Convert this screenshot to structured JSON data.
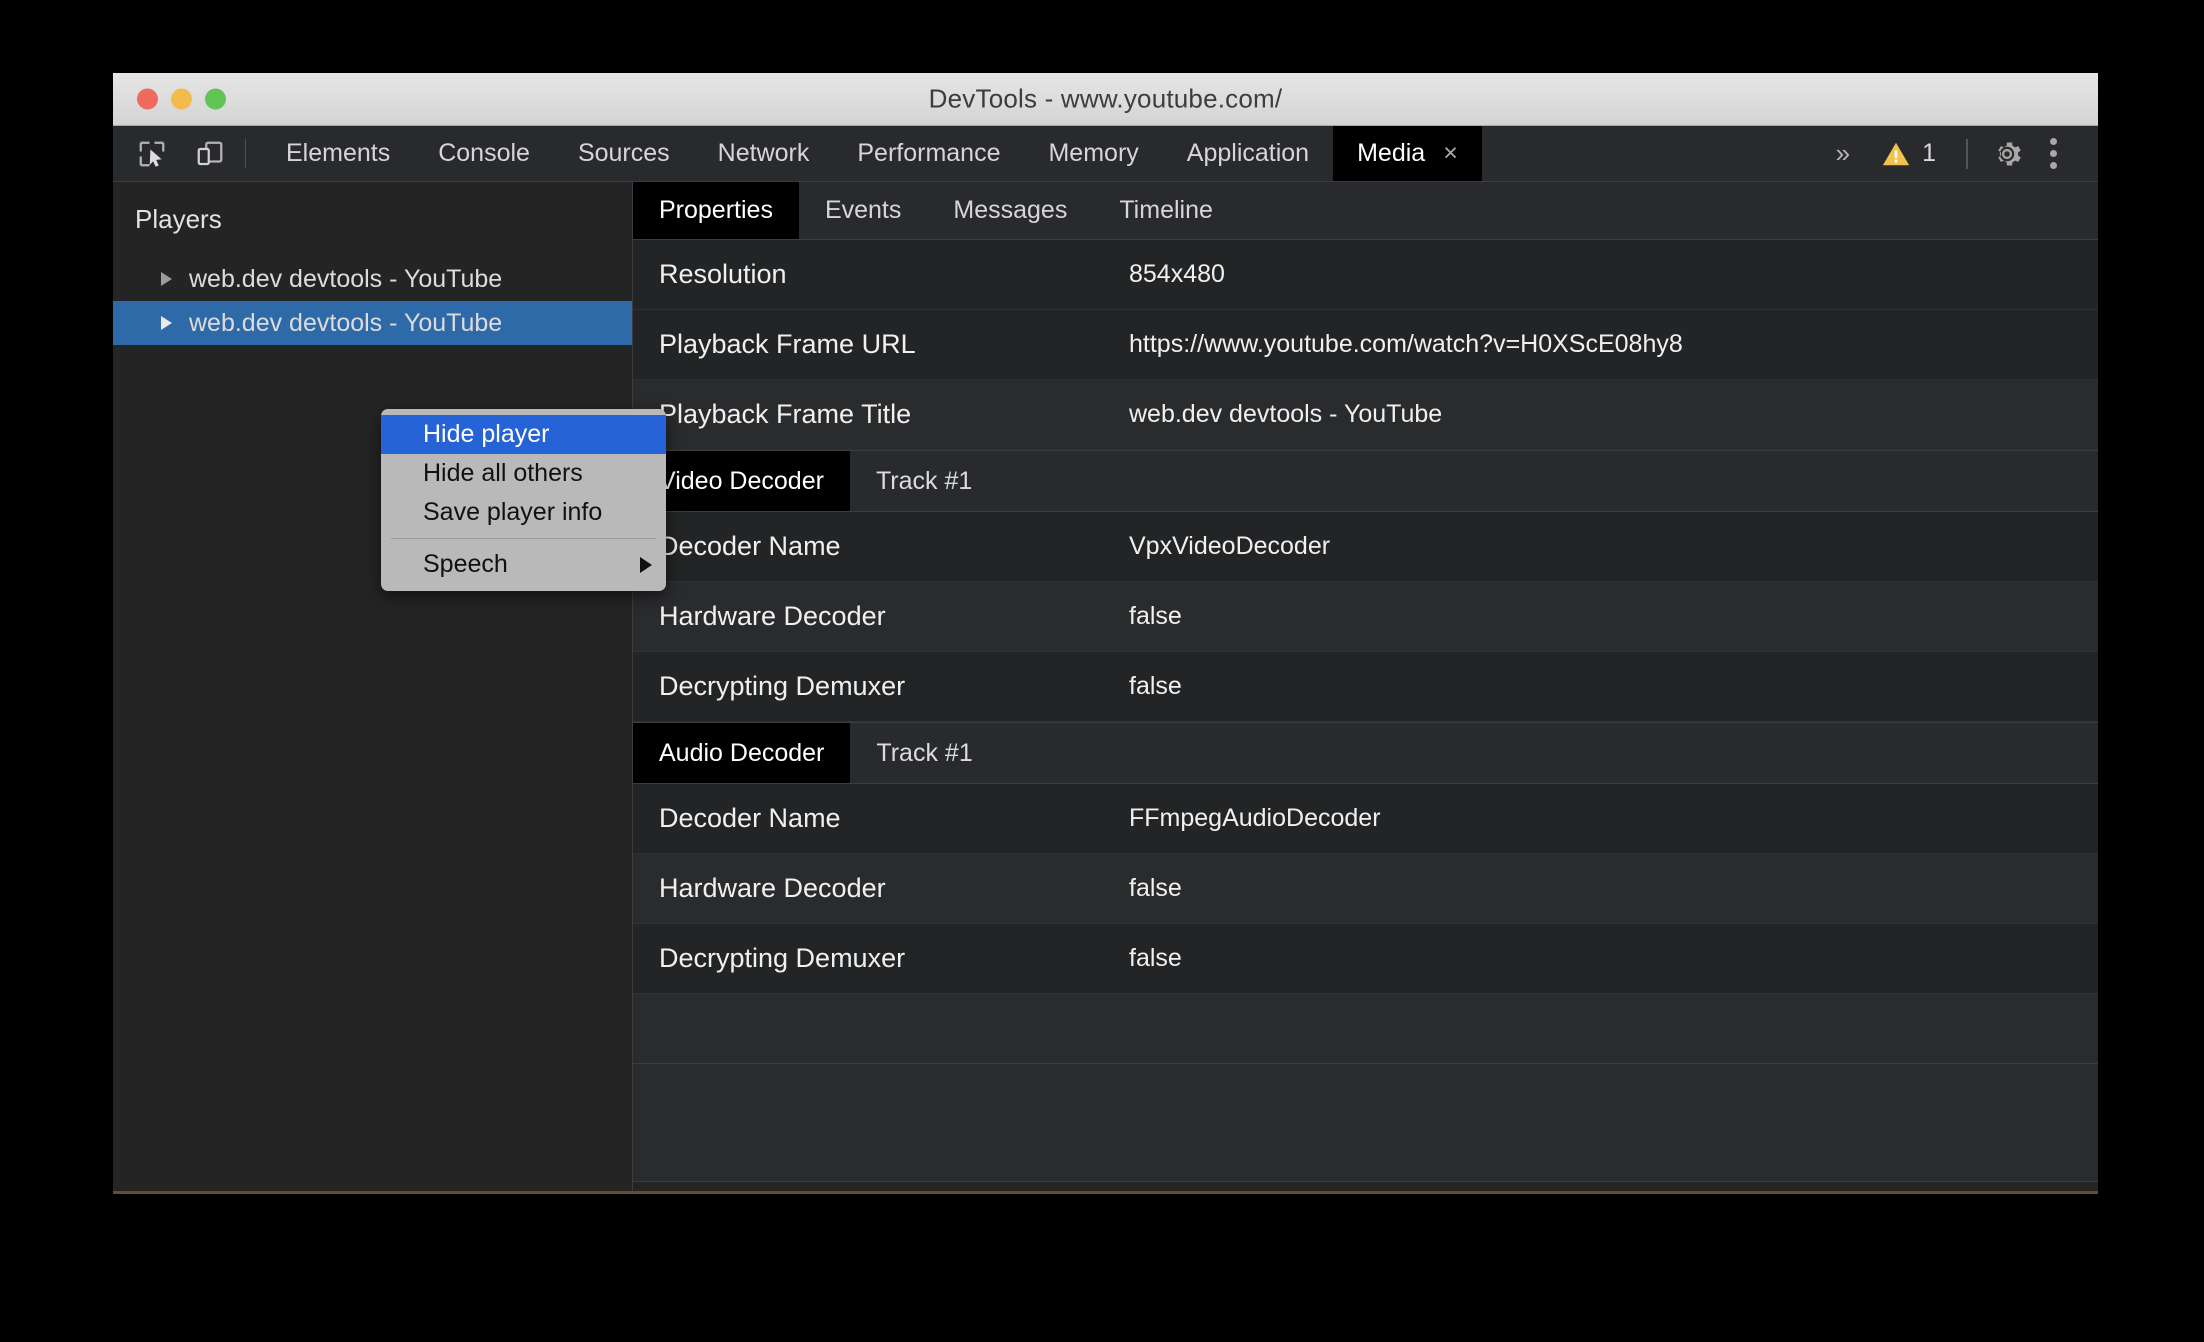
{
  "window": {
    "title": "DevTools - www.youtube.com/",
    "traffic_lights": [
      "close",
      "minimize",
      "zoom"
    ]
  },
  "toolbar": {
    "inspect_icon": "inspect-cursor-icon",
    "device_icon": "device-toolbar-icon",
    "tabs": [
      {
        "label": "Elements",
        "active": false,
        "closable": false
      },
      {
        "label": "Console",
        "active": false,
        "closable": false
      },
      {
        "label": "Sources",
        "active": false,
        "closable": false
      },
      {
        "label": "Network",
        "active": false,
        "closable": false
      },
      {
        "label": "Performance",
        "active": false,
        "closable": false
      },
      {
        "label": "Memory",
        "active": false,
        "closable": false
      },
      {
        "label": "Application",
        "active": false,
        "closable": false
      },
      {
        "label": "Media",
        "active": true,
        "closable": true
      }
    ],
    "close_glyph": "×",
    "more_tabs_glyph": "»",
    "warning_icon": "warning-triangle-icon",
    "warning_count": "1",
    "warning_color": "#f2c14e",
    "settings_icon": "gear-icon",
    "menu_icon": "kebab-menu-icon"
  },
  "sidebar": {
    "title": "Players",
    "players": [
      {
        "label": "web.dev devtools - YouTube",
        "selected": false
      },
      {
        "label": "web.dev devtools - YouTube",
        "selected": true
      }
    ]
  },
  "main": {
    "tabs": [
      {
        "label": "Properties",
        "active": true
      },
      {
        "label": "Events",
        "active": false
      },
      {
        "label": "Messages",
        "active": false
      },
      {
        "label": "Timeline",
        "active": false
      }
    ],
    "properties": [
      {
        "key": "Resolution",
        "value": "854x480"
      },
      {
        "key": "Playback Frame URL",
        "value": "https://www.youtube.com/watch?v=H0XScE08hy8"
      },
      {
        "key": "Playback Frame Title",
        "value": "web.dev devtools - YouTube"
      }
    ],
    "video_decoder": {
      "section_label": "Video Decoder",
      "track_label": "Track #1",
      "rows": [
        {
          "key": "Decoder Name",
          "value": "VpxVideoDecoder"
        },
        {
          "key": "Hardware Decoder",
          "value": "false"
        },
        {
          "key": "Decrypting Demuxer",
          "value": "false"
        }
      ]
    },
    "audio_decoder": {
      "section_label": "Audio Decoder",
      "track_label": "Track #1",
      "rows": [
        {
          "key": "Decoder Name",
          "value": "FFmpegAudioDecoder"
        },
        {
          "key": "Hardware Decoder",
          "value": "false"
        },
        {
          "key": "Decrypting Demuxer",
          "value": "false"
        }
      ]
    }
  },
  "context_menu": {
    "items": [
      {
        "label": "Hide player",
        "highlighted": true,
        "submenu": false
      },
      {
        "label": "Hide all others",
        "highlighted": false,
        "submenu": false
      },
      {
        "label": "Save player info",
        "highlighted": false,
        "submenu": false
      }
    ],
    "submenu_item": {
      "label": "Speech",
      "submenu": true
    },
    "submenu_arrow": "triangle-right-icon"
  },
  "colors": {
    "accent_selection": "#2f6aa8",
    "menu_highlight": "#2563d6",
    "warning": "#f2c14e",
    "panel_bg": "#242424"
  }
}
